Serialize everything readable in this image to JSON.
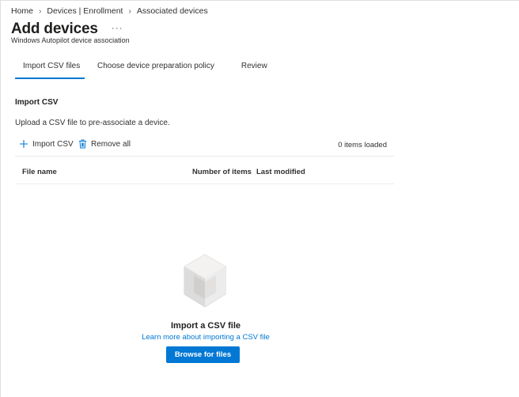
{
  "breadcrumb": {
    "items": [
      "Home",
      "Devices | Enrollment",
      "Associated devices"
    ],
    "separator": ">"
  },
  "header": {
    "title": "Add devices",
    "more_label": "···",
    "subtitle": "Windows Autopilot device association"
  },
  "tabs": [
    {
      "label": "Import CSV files",
      "active": true
    },
    {
      "label": "Choose device preparation policy",
      "active": false
    },
    {
      "label": "Review",
      "active": false
    }
  ],
  "section": {
    "title": "Import CSV",
    "description": "Upload a CSV file to pre-associate a device."
  },
  "toolbar": {
    "import_label": "Import CSV",
    "remove_label": "Remove all",
    "items_loaded": "0 items loaded"
  },
  "table": {
    "columns": [
      "File name",
      "Number of items",
      "Last modified"
    ],
    "rows": []
  },
  "empty_state": {
    "title": "Import a CSV file",
    "link_text": "Learn more about importing a CSV file",
    "button_label": "Browse for files"
  },
  "colors": {
    "accent": "#0078d4",
    "text": "#323130",
    "divider": "#edebe9"
  },
  "icons": {
    "import": "plus-icon",
    "remove": "trash-icon",
    "empty": "csv-cube-icon"
  }
}
